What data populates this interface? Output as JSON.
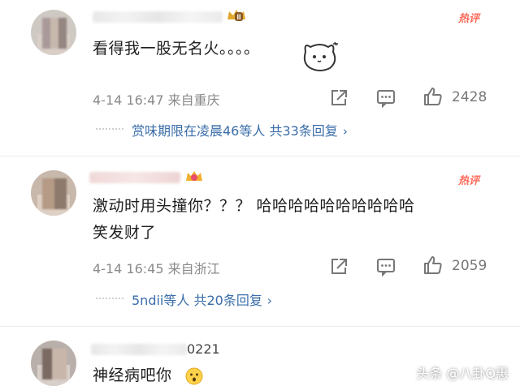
{
  "comments": [
    {
      "text_lines": [
        "看得我一股无名火。。。。"
      ],
      "hot": "热评",
      "meta": "4-14 16:47 来自重庆",
      "likes": "2428",
      "replies": "赏味期限在凌晨46等人  共33条回复"
    },
    {
      "text_lines": [
        "激动时用头撞你？？？ 哈哈哈哈哈哈哈哈哈哈",
        "笑发财了"
      ],
      "hot": "热评",
      "meta": "4-14 16:45 来自浙江",
      "likes": "2059",
      "replies": "5ndii等人  共20条回复"
    },
    {
      "name_visible": "0221",
      "text_lines": [
        "神经病吧你"
      ]
    }
  ],
  "watermark": "头条 @八卦Q惠",
  "icons": [
    "share-icon",
    "comment-icon",
    "thumbs-up-icon",
    "chevron-right-icon",
    "crown-badge-icon",
    "surprised-emoji-icon",
    "cat-sticker-icon"
  ]
}
